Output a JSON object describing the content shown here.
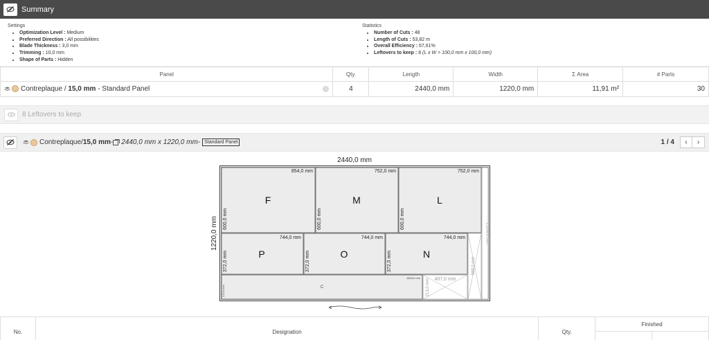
{
  "header": {
    "title": "Summary",
    "toggle_icon": "eye-slash-icon"
  },
  "settings": {
    "heading": "Settings",
    "items": [
      {
        "label": "Optimization Level :",
        "value": " Medium"
      },
      {
        "label": "Preferred Direction :",
        "value": " All possibilities"
      },
      {
        "label": "Blade Thickness :",
        "value": " 3,0 mm"
      },
      {
        "label": "Trimming :",
        "value": " 10,0 mm"
      },
      {
        "label": "Shape of Parts :",
        "value": " Hidden"
      }
    ]
  },
  "statistics": {
    "heading": "Statistics",
    "items": [
      {
        "label": "Number of Cuts :",
        "value": " 48",
        "note": ""
      },
      {
        "label": "Length of Cuts :",
        "value": " 53,82 m",
        "note": ""
      },
      {
        "label": "Overall Efficiency :",
        "value": " 67,61%",
        "note": ""
      },
      {
        "label": "Leftovers to keep :",
        "value": " 8 ",
        "note": "(L x W > 100,0 mm x 100,0 mm)"
      }
    ]
  },
  "panel_table": {
    "columns": [
      "Panel",
      "Qty.",
      "Length",
      "Width",
      "Σ Area",
      "# Parts"
    ],
    "row": {
      "material": "Contreplaque",
      "separator": " / ",
      "thickness": "15,0 mm",
      "type": " - Standard Panel",
      "qty": "4",
      "length": "2440,0 mm",
      "width": "1220,0 mm",
      "area": "11,91 m²",
      "parts": "30",
      "info_icon": "info-icon"
    }
  },
  "leftovers": {
    "label": "8 Leftovers to keep",
    "icon": "eye-icon"
  },
  "panel_bar": {
    "material": "Contreplaque",
    "separator": " / ",
    "thickness": "15,0 mm",
    "dash1": " - ",
    "dimensions": "2440,0 mm x 1220,0 mm",
    "dash2": " - ",
    "badge": "Standard Panel",
    "pager": "1 / 4",
    "prev": "‹",
    "next": "›"
  },
  "cutting_diagram": {
    "panel_length": "2440,0 mm",
    "panel_width": "1220,0 mm",
    "parts": [
      {
        "letter": "F",
        "length": "854,0 mm",
        "width": "600,0 mm"
      },
      {
        "letter": "M",
        "length": "752,0 mm",
        "width": "600,0 mm"
      },
      {
        "letter": "L",
        "length": "752,0 mm",
        "width": "600,0 mm"
      },
      {
        "letter": "P",
        "length": "744,0 mm",
        "width": "372,0 mm"
      },
      {
        "letter": "O",
        "length": "744,0 mm",
        "width": "372,0 mm"
      },
      {
        "letter": "N",
        "length": "744,0 mm",
        "width": "372,0 mm"
      },
      {
        "letter": "C",
        "length": "1828,0 mm",
        "width": "213,0 mm"
      }
    ],
    "waste_labels": {
      "right_strip": "1,209,0 mm",
      "right_block": "588,0 mm",
      "bottom_block_len": "407,0 mm",
      "bottom_block_wid": "213,0 mm"
    }
  },
  "parts_table": {
    "columns": [
      "No.",
      "Designation",
      "Qty.",
      "Finished"
    ]
  }
}
